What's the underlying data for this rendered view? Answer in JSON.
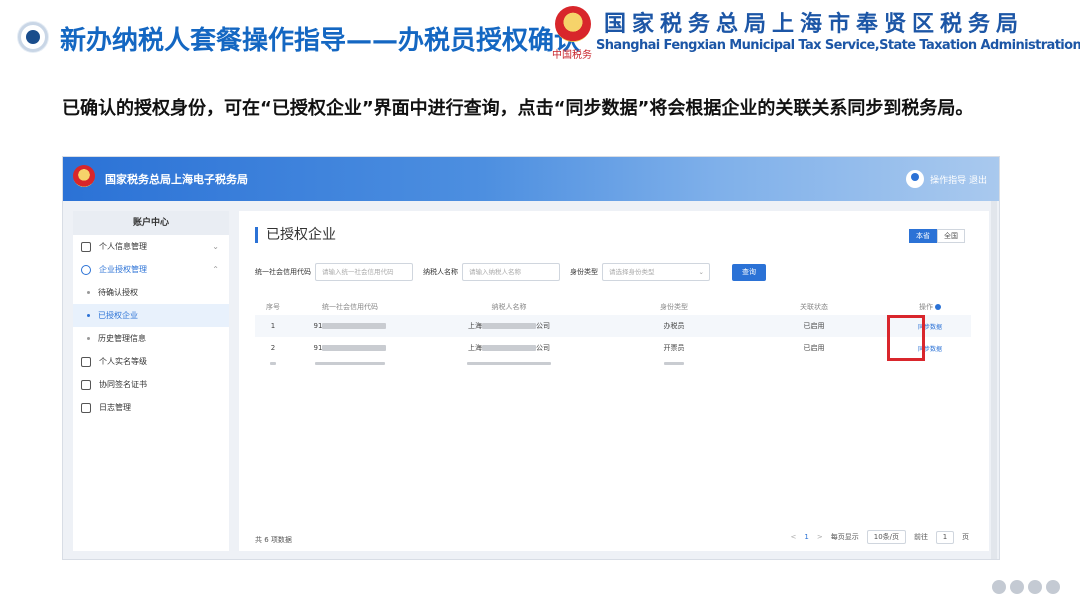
{
  "slide": {
    "title": "新办纳税人套餐操作指导——办税员授权确认",
    "org_cn": "国家税务总局上海市奉贤区税务局",
    "org_en": "Shanghai Fengxian Municipal Tax Service,State Taxation Administration",
    "emblem_caption": "中国税务",
    "description": "已确认的授权身份，可在“已授权企业”界面中进行查询，点击“同步数据”将会根据企业的关联关系同步到税务局。"
  },
  "app": {
    "title": "国家税务总局上海电子税务局",
    "user_text": "操作指导 退出"
  },
  "sidebar": {
    "header": "账户中心",
    "items": [
      {
        "label": "个人信息管理",
        "icon": "id-card-icon",
        "chevron": "⌄"
      },
      {
        "label": "企业授权管理",
        "icon": "shield-check-icon",
        "chevron": "⌃"
      },
      {
        "label": "待确认授权"
      },
      {
        "label": "已授权企业"
      },
      {
        "label": "历史管理信息"
      },
      {
        "label": "个人实名等级",
        "icon": "person-icon"
      },
      {
        "label": "协同签名证书",
        "icon": "certificate-icon"
      },
      {
        "label": "日志管理",
        "icon": "log-icon"
      }
    ]
  },
  "main": {
    "page_title": "已授权企业",
    "scope": {
      "current": "本省",
      "all": "全国"
    },
    "filters": {
      "credit_code_label": "统一社会信用代码",
      "credit_code_placeholder": "请输入统一社会信用代码",
      "taxpayer_name_label": "纳税人名称",
      "taxpayer_name_placeholder": "请输入纳税人名称",
      "identity_label": "身份类型",
      "identity_placeholder": "请选择身份类型",
      "query_button": "查询"
    },
    "table": {
      "headers": [
        "序号",
        "统一社会信用代码",
        "纳税人名称",
        "身份类型",
        "关联状态",
        "操作"
      ],
      "rows": [
        {
          "index": "1",
          "code": "91",
          "name_prefix": "上海",
          "name_suffix": "公司",
          "identity": "办税员",
          "status": "已启用",
          "action": "同步数据"
        },
        {
          "index": "2",
          "code": "91",
          "name_prefix": "上海",
          "name_suffix": "公司",
          "identity": "开票员",
          "status": "已启用",
          "action": "同步数据"
        }
      ]
    },
    "total": "共 6 项数据",
    "pager": {
      "prev": "<",
      "page": "1",
      "next": ">",
      "page_size_label": "每页显示",
      "page_size": "10条/页",
      "goto_label": "前往",
      "goto_value": "1",
      "goto_unit": "页"
    }
  },
  "colors": {
    "accent": "#2b72d6",
    "title_blue": "#1467c2",
    "highlight_red": "#d9262c"
  }
}
